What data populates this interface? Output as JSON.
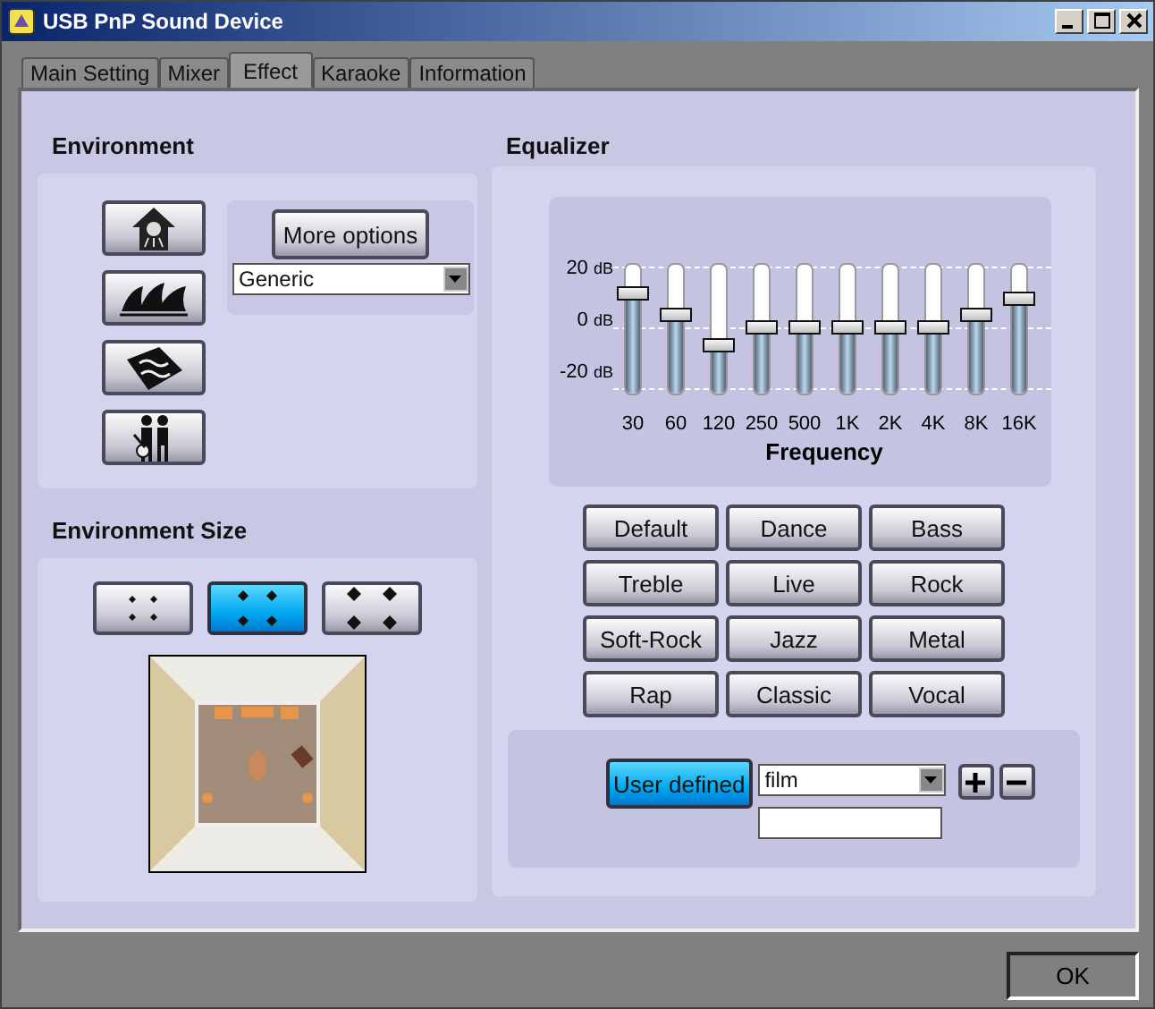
{
  "window": {
    "title": "USB PnP Sound Device"
  },
  "tabs": [
    {
      "label": "Main Setting",
      "selected": false
    },
    {
      "label": "Mixer",
      "selected": false
    },
    {
      "label": "Effect",
      "selected": true
    },
    {
      "label": "Karaoke",
      "selected": false
    },
    {
      "label": "Information",
      "selected": false
    }
  ],
  "environment": {
    "title": "Environment",
    "presets": [
      {
        "kind": "shower"
      },
      {
        "kind": "opera"
      },
      {
        "kind": "wave"
      },
      {
        "kind": "performers"
      }
    ],
    "more_options": "More options",
    "dropdown": {
      "value": "Generic"
    }
  },
  "environment_size": {
    "title": "Environment Size",
    "sizes": [
      {
        "kind": "small",
        "selected": false
      },
      {
        "kind": "medium",
        "selected": true
      },
      {
        "kind": "large",
        "selected": false
      }
    ]
  },
  "equalizer": {
    "title": "Equalizer",
    "scale": [
      {
        "value": "20",
        "unit": "dB"
      },
      {
        "value": "0",
        "unit": "dB"
      },
      {
        "value": "-20",
        "unit": "dB"
      }
    ],
    "bands": [
      {
        "label": "30",
        "level": 0.8
      },
      {
        "label": "60",
        "level": 0.62
      },
      {
        "label": "120",
        "level": 0.35
      },
      {
        "label": "250",
        "level": 0.5
      },
      {
        "label": "500",
        "level": 0.5
      },
      {
        "label": "1K",
        "level": 0.5
      },
      {
        "label": "2K",
        "level": 0.5
      },
      {
        "label": "4K",
        "level": 0.5
      },
      {
        "label": "8K",
        "level": 0.62
      },
      {
        "label": "16K",
        "level": 0.75
      }
    ],
    "axis_label": "Frequency",
    "presets": [
      "Default",
      "Dance",
      "Bass",
      "Treble",
      "Live",
      "Rock",
      "Soft-Rock",
      "Jazz",
      "Metal",
      "Rap",
      "Classic",
      "Vocal"
    ],
    "user": {
      "label": "User defined",
      "on": true,
      "preset": "film"
    }
  },
  "ok_button": "OK"
}
